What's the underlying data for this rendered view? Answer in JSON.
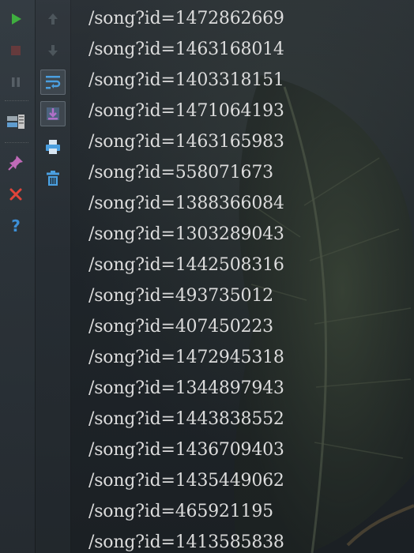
{
  "toolbar": {
    "left": [
      {
        "name": "run-icon",
        "color": "#3fae3f",
        "enabled": true
      },
      {
        "name": "stop-icon",
        "color": "#8a3b3b",
        "enabled": false
      },
      {
        "name": "pause-icon",
        "color": "#6f7a80",
        "enabled": false
      },
      {
        "name": "dump-threads-icon",
        "color": "#9aa6ae",
        "enabled": true
      },
      {
        "name": "pin-tab-icon",
        "color": "#c06ab8",
        "enabled": true
      },
      {
        "name": "close-icon",
        "color": "#e0443a",
        "enabled": true
      },
      {
        "name": "help-icon",
        "color": "#3d8fd6",
        "enabled": true
      }
    ],
    "right": [
      {
        "name": "up-arrow-icon",
        "color": "#5a646a",
        "enabled": false
      },
      {
        "name": "down-arrow-icon",
        "color": "#5a646a",
        "enabled": false
      },
      {
        "name": "soft-wrap-icon",
        "color": "#4a9fe0",
        "enabled": true,
        "pressed": true
      },
      {
        "name": "scroll-to-end-icon",
        "color": "#b070c8",
        "enabled": true,
        "pressed": true
      },
      {
        "name": "print-icon",
        "color": "#4a9fe0",
        "enabled": true
      },
      {
        "name": "clear-trash-icon",
        "color": "#4a9fe0",
        "enabled": true
      }
    ]
  },
  "console": {
    "lines": [
      "/song?id=1472862669",
      "/song?id=1463168014",
      "/song?id=1403318151",
      "/song?id=1471064193",
      "/song?id=1463165983",
      "/song?id=558071673",
      "/song?id=1388366084",
      "/song?id=1303289043",
      "/song?id=1442508316",
      "/song?id=493735012",
      "/song?id=407450223",
      "/song?id=1472945318",
      "/song?id=1344897943",
      "/song?id=1443838552",
      "/song?id=1436709403",
      "/song?id=1435449062",
      "/song?id=465921195",
      "/song?id=1413585838"
    ]
  }
}
